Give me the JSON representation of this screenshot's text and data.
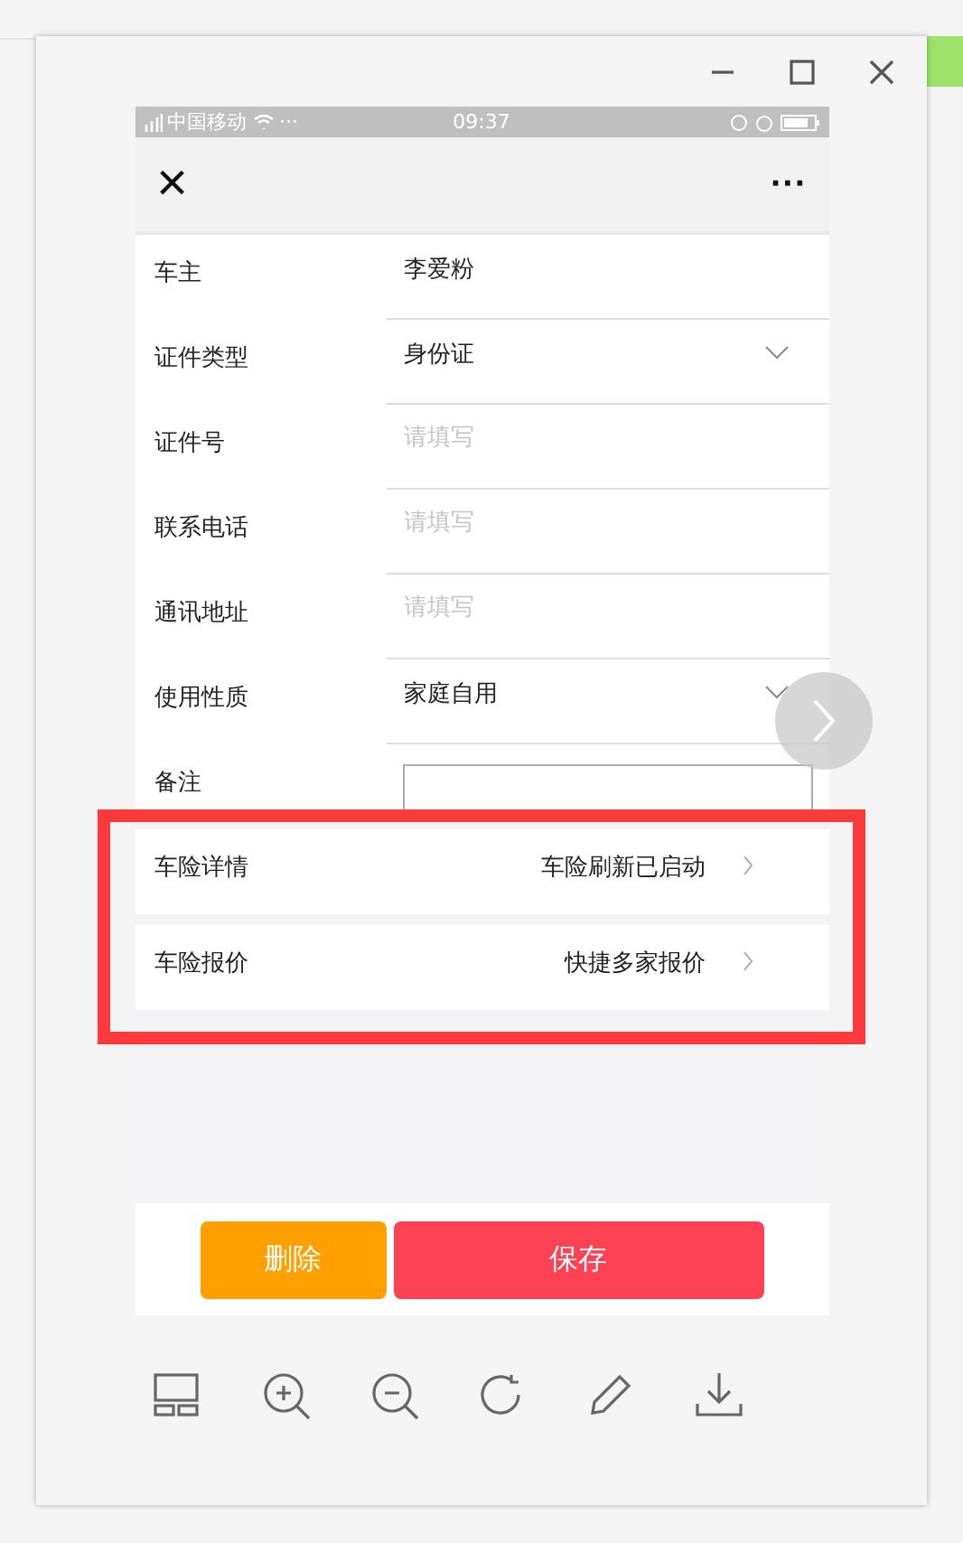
{
  "status_bar": {
    "carrier": "中国移动",
    "dots": "···",
    "time": "09:37"
  },
  "nav": {
    "close": "×",
    "more": "···"
  },
  "form": [
    {
      "kind": "text",
      "label": "车主",
      "value": "李爱粉"
    },
    {
      "kind": "select",
      "label": "证件类型",
      "value": "身份证"
    },
    {
      "kind": "text",
      "label": "证件号",
      "placeholder": "请填写"
    },
    {
      "kind": "text",
      "label": "联系电话",
      "placeholder": "请填写"
    },
    {
      "kind": "text",
      "label": "通讯地址",
      "placeholder": "请填写"
    },
    {
      "kind": "select",
      "label": "使用性质",
      "value": "家庭自用"
    },
    {
      "kind": "textarea",
      "label": "备注"
    }
  ],
  "insurance": [
    {
      "label": "车险详情",
      "value": "车险刷新已启动"
    },
    {
      "label": "车险报价",
      "value": "快捷多家报价"
    }
  ],
  "buttons": [
    {
      "kind": "delete",
      "label": "删除"
    },
    {
      "kind": "save",
      "label": "保存"
    }
  ]
}
